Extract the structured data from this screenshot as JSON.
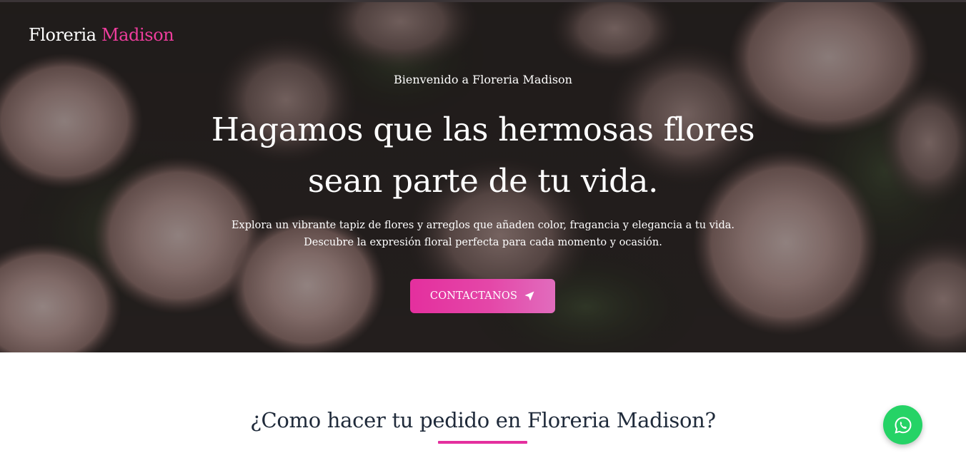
{
  "header": {
    "brand_first": "Floreria",
    "brand_second": "Madison"
  },
  "hero": {
    "welcome": "Bienvenido a Floreria Madison",
    "headline_line1": "Hagamos que las hermosas flores",
    "headline_line2": "sean parte de tu vida.",
    "subtext_line1": "Explora un vibrante tapiz de flores y arreglos que añaden color, fragancia y elegancia a tu vida.",
    "subtext_line2": "Descubre la expresión floral perfecta para cada momento y ocasión.",
    "cta_label": "CONTACTANOS",
    "cta_icon": "paper-plane-icon",
    "background_image": "pink-roses-photo"
  },
  "section": {
    "title": "¿Como hacer tu pedido en Floreria Madison?"
  },
  "floating": {
    "whatsapp_icon": "whatsapp-icon"
  },
  "colors": {
    "accent": "#e42f9e",
    "brand_accent": "#ee3d9d",
    "whatsapp": "#25d366",
    "title_text": "#1f2a3a",
    "hero_overlay": "#2c2626"
  }
}
